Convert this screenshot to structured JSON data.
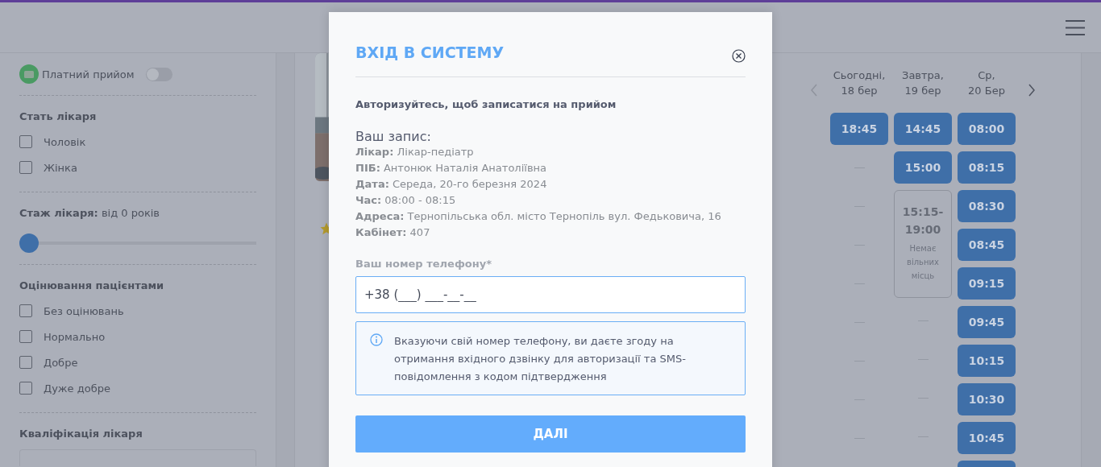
{
  "sidebar": {
    "paid": {
      "label": "Платний прийом",
      "on": false
    },
    "sections": [
      {
        "title": "Стать лікаря",
        "kind": "checkboxes",
        "options": [
          {
            "label": "Чоловік",
            "checked": false
          },
          {
            "label": "Жінка",
            "checked": false
          }
        ]
      },
      {
        "title": "**Стаж лікаря:** від 0 років",
        "kind": "slider",
        "level": 0
      },
      {
        "title": "Оцінювання пацієнтами",
        "kind": "checkboxes",
        "options": [
          {
            "label": "Без оцінювань",
            "checked": false
          },
          {
            "label": "Нормально",
            "checked": false
          },
          {
            "label": "Добре",
            "checked": false
          },
          {
            "label": "Дуже добре",
            "checked": false
          }
        ]
      },
      {
        "title": "Кваліфікація лікаря",
        "kind": "select"
      }
    ]
  },
  "schedule": {
    "prev_disabled": true,
    "days": [
      {
        "weekday": "Сьогодні,",
        "date": "18 бер",
        "slots": [
          {
            "kind": "time",
            "time": "18:45"
          },
          {
            "kind": "empty"
          },
          {
            "kind": "empty"
          },
          {
            "kind": "empty"
          },
          {
            "kind": "empty"
          },
          {
            "kind": "empty"
          },
          {
            "kind": "empty"
          },
          {
            "kind": "empty"
          },
          {
            "kind": "empty"
          }
        ]
      },
      {
        "weekday": "Завтра,",
        "date": "19 бер",
        "slots": [
          {
            "kind": "time",
            "time": "14:45"
          },
          {
            "kind": "time",
            "time": "15:00"
          },
          {
            "kind": "unavailable",
            "range": "15:15-19:00",
            "note": "Немає вільних місць"
          },
          {
            "kind": "empty"
          },
          {
            "kind": "empty"
          },
          {
            "kind": "empty"
          },
          {
            "kind": "empty"
          }
        ]
      },
      {
        "weekday": "Ср,",
        "date": "20 Бер",
        "slots": [
          {
            "kind": "time",
            "time": "08:00"
          },
          {
            "kind": "time",
            "time": "08:15"
          },
          {
            "kind": "time",
            "time": "08:30"
          },
          {
            "kind": "time",
            "time": "08:45"
          },
          {
            "kind": "time",
            "time": "09:15"
          },
          {
            "kind": "time",
            "time": "09:45"
          },
          {
            "kind": "time",
            "time": "10:15"
          },
          {
            "kind": "time",
            "time": "10:30"
          },
          {
            "kind": "time",
            "time": "10:45"
          },
          {
            "kind": "time"
          }
        ]
      }
    ]
  },
  "modal": {
    "title": "ВХІД В СИСТЕМУ",
    "subtitle": "Авторизуйтесь, щоб записатися на прийом",
    "record_title": "Ваш запис:",
    "details": [
      {
        "label": "Лікар:",
        "value": "Лікар-педіатр"
      },
      {
        "label": "ПІБ:",
        "value": "Антонюк Наталія Анатоліївна"
      },
      {
        "label": "Дата:",
        "value": "Середа, 20-го березня 2024"
      },
      {
        "label": "Час:",
        "value": "08:00 - 08:15"
      },
      {
        "label": "Адреса:",
        "value": "Тернопільська обл. місто Тернопіль вул. Федьковича, 16"
      },
      {
        "label": "Кабінет:",
        "value": "407"
      }
    ],
    "phone_label": "Ваш номер телефону*",
    "phone_value": "+38 (___) ___-__-__",
    "notice": "Вказуючи свій номер телефону, ви даєте згоду на отримання вхідного дзвінку для авторизації та SMS-повідомлення з кодом підтвердження",
    "button": "ДАЛІ"
  }
}
